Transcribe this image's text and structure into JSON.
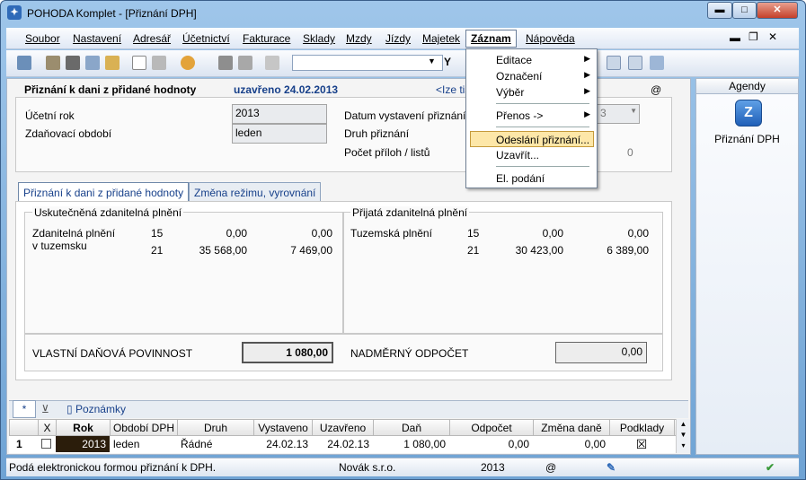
{
  "window": {
    "title": "POHODA Komplet - [Přiznání DPH]",
    "min_btn": "▬",
    "max_btn": "□",
    "close_btn": "✕",
    "inner_min": "▬",
    "inner_max": "❐",
    "inner_close": "✕"
  },
  "menu": {
    "items": [
      "Soubor",
      "Nastavení",
      "Adresář",
      "Účetnictví",
      "Fakturace",
      "Sklady",
      "Mzdy",
      "Jízdy",
      "Majetek",
      "Záznam",
      "Nápověda"
    ],
    "active": "Záznam"
  },
  "dropdown": {
    "items": [
      {
        "label": "Editace",
        "submenu": true
      },
      {
        "label": "Označení",
        "submenu": true
      },
      {
        "label": "Výběr",
        "submenu": true
      },
      {
        "label": "Přenos ->",
        "submenu": true
      },
      {
        "label": "Odeslání přiznání...",
        "submenu": false,
        "highlighted": true
      },
      {
        "label": "Uzavřít...",
        "submenu": false
      },
      {
        "label": "El. podání",
        "submenu": false
      }
    ]
  },
  "header": {
    "title": "Přiznání k dani z přidané hodnoty",
    "status": "uzavřeno 24.02.2013",
    "link": "<Ize tis",
    "at": "@"
  },
  "form": {
    "ucetni_rok_label": "Účetní rok",
    "ucetni_rok_value": "2013",
    "zdanovaci_label": "Zdaňovací období",
    "zdanovaci_value": "leden",
    "datum_label": "Datum vystavení přiznání",
    "druh_label": "Druh přiznání",
    "pocet_label": "Počet příloh / listů",
    "field_3": "3",
    "field_0": "0"
  },
  "tabs": [
    "Přiznání k dani z přidané hodnoty",
    "Změna režimu, vyrovnání"
  ],
  "uskutecnena": {
    "title": "Uskutečněná zdanitelná plnění",
    "label1": "Zdanitelná plnění",
    "label2": "v tuzemsku",
    "rows": [
      {
        "code": "15",
        "base": "0,00",
        "tax": "0,00"
      },
      {
        "code": "21",
        "base": "35 568,00",
        "tax": "7 469,00"
      }
    ]
  },
  "prijata": {
    "title": "Přijatá zdanitelná plnění",
    "label": "Tuzemská plnění",
    "rows": [
      {
        "code": "15",
        "base": "0,00",
        "tax": "0,00"
      },
      {
        "code": "21",
        "base": "30 423,00",
        "tax": "6 389,00"
      }
    ]
  },
  "summary": {
    "vlastni_label": "VLASTNÍ DAŇOVÁ POVINNOST",
    "vlastni_value": "1 080,00",
    "nadmerny_label": "NADMĚRNÝ ODPOČET",
    "nadmerny_value": "0,00"
  },
  "bottom_tabs": {
    "poznamky": "Poznámky"
  },
  "grid": {
    "columns": [
      "X",
      "Rok",
      "Období DPH",
      "Druh",
      "Vystaveno",
      "Uzavřeno",
      "Daň",
      "Odpočet",
      "Změna daně",
      "Podklady"
    ],
    "rows": [
      {
        "num": "1",
        "rok": "2013",
        "obdobi": "leden",
        "druh": "Řádné",
        "vystaveno": "24.02.13",
        "uzavreno": "24.02.13",
        "dan": "1 080,00",
        "odpocet": "0,00",
        "zmena": "0,00",
        "podklady": "☒"
      }
    ]
  },
  "status": {
    "message": "Podá elektronickou formou přiznání k DPH.",
    "company": "Novák s.r.o.",
    "year": "2013",
    "at": "@"
  },
  "agenda": {
    "title": "Agendy",
    "item": "Přiznání DPH"
  }
}
